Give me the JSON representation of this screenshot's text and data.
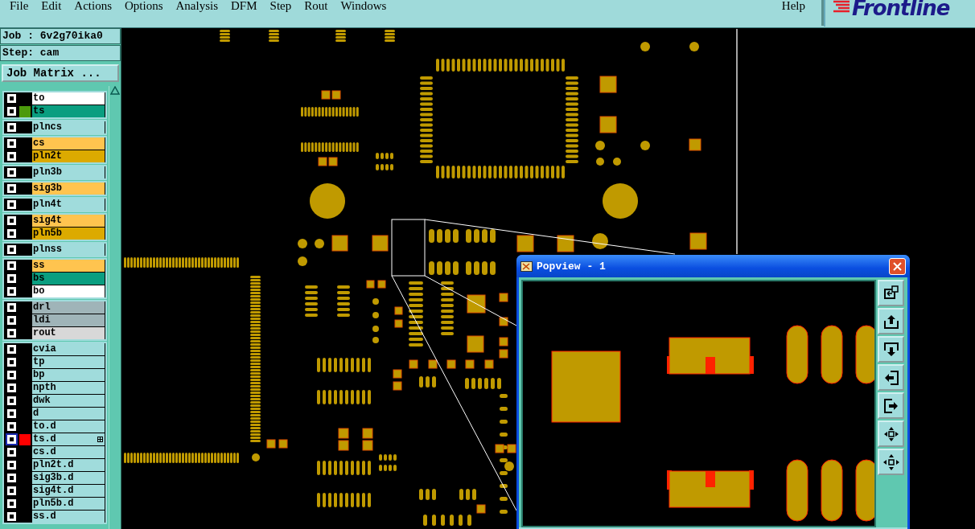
{
  "menu": [
    "File",
    "Edit",
    "Actions",
    "Options",
    "Analysis",
    "DFM",
    "Step",
    "Rout",
    "Windows"
  ],
  "help": "Help",
  "logo": "Frontline",
  "job": "Job : 6v2g70ika0",
  "step": "Step: cam",
  "job_matrix_button": "Job Matrix ...",
  "layer_groups": [
    [
      {
        "name": "to",
        "color": "#ffffff",
        "selected": false
      },
      {
        "name": "ts",
        "color": "#0a9e80",
        "swatch": {
          "color": "#4c9a0c"
        },
        "selected": false
      }
    ],
    [
      {
        "name": "plncs",
        "color": "#a0dcdc",
        "selected": false
      }
    ],
    [
      {
        "name": "cs",
        "color": "#ffc44f",
        "selected": false
      },
      {
        "name": "pln2t",
        "color": "#dcaa00",
        "selected": false
      }
    ],
    [
      {
        "name": "pln3b",
        "color": "#a0dcdc",
        "selected": false
      }
    ],
    [
      {
        "name": "sig3b",
        "color": "#ffc44f",
        "selected": false
      }
    ],
    [
      {
        "name": "pln4t",
        "color": "#a0dcdc",
        "selected": false
      }
    ],
    [
      {
        "name": "sig4t",
        "color": "#ffc44f",
        "selected": false
      },
      {
        "name": "pln5b",
        "color": "#dcaa00",
        "selected": false
      }
    ],
    [
      {
        "name": "plnss",
        "color": "#a0dcdc",
        "selected": false
      }
    ],
    [
      {
        "name": "ss",
        "color": "#ffc44f",
        "selected": false
      },
      {
        "name": "bs",
        "color": "#0a9e80",
        "selected": false
      },
      {
        "name": "bo",
        "color": "#ffffff",
        "selected": false
      }
    ],
    [
      {
        "name": "drl",
        "color": "#9fb4b8",
        "selected": false
      },
      {
        "name": "ldi",
        "color": "#9fb4b8",
        "selected": false
      },
      {
        "name": "rout",
        "color": "#d8d8d8",
        "selected": false
      }
    ],
    [
      {
        "name": "cvia",
        "color": "#a0dcdc",
        "selected": false
      },
      {
        "name": "tp",
        "color": "#a0dcdc",
        "selected": false
      },
      {
        "name": "bp",
        "color": "#a0dcdc",
        "selected": false
      },
      {
        "name": "npth",
        "color": "#a0dcdc",
        "selected": false
      },
      {
        "name": "dwk",
        "color": "#a0dcdc",
        "selected": false
      },
      {
        "name": "d",
        "color": "#a0dcdc",
        "selected": false
      },
      {
        "name": "to.d",
        "color": "#a0dcdc",
        "selected": false
      },
      {
        "name": "ts.d",
        "color": "#a0dcdc",
        "swatch": {
          "color": "#ff0000"
        },
        "selected": true
      },
      {
        "name": "cs.d",
        "color": "#a0dcdc",
        "selected": false
      },
      {
        "name": "pln2t.d",
        "color": "#a0dcdc",
        "selected": false
      },
      {
        "name": "sig3b.d",
        "color": "#a0dcdc",
        "selected": false
      },
      {
        "name": "sig4t.d",
        "color": "#a0dcdc",
        "selected": false
      },
      {
        "name": "pln5b.d",
        "color": "#a0dcdc",
        "selected": false
      },
      {
        "name": "ss.d",
        "color": "#a0dcdc",
        "selected": false
      }
    ]
  ],
  "popview": {
    "title": "Popview - 1"
  }
}
